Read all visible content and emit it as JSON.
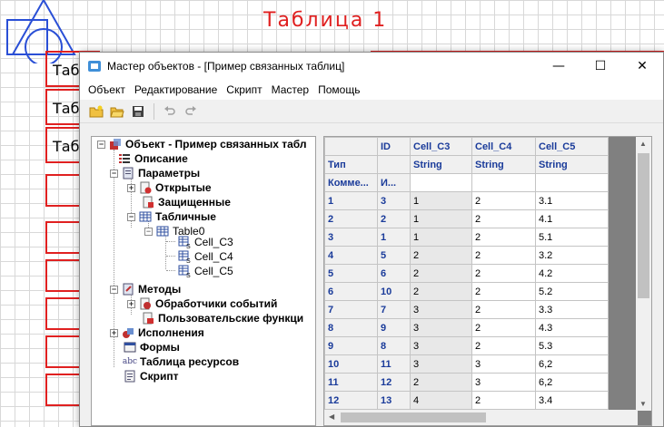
{
  "background": {
    "drawing_title": "Таблица 1",
    "row_labels": [
      "Таб",
      "Таб",
      "Таб"
    ]
  },
  "window": {
    "title": "Мастер объектов - [Пример связанных таблиц]",
    "minimize": "—",
    "maximize": "☐",
    "close": "✕"
  },
  "menu": [
    "Объект",
    "Редактирование",
    "Скрипт",
    "Мастер",
    "Помощь"
  ],
  "toolbar": {
    "icons": [
      "new-folder-icon",
      "open-folder-icon",
      "save-icon",
      "undo-icon",
      "redo-icon"
    ]
  },
  "tree": {
    "root": "Объект - Пример связанных табл",
    "description": "Описание",
    "parameters": "Параметры",
    "open": "Открытые",
    "protected": "Защищенные",
    "tabular": "Табличные",
    "table0": "Table0",
    "cells": [
      "Cell_C3",
      "Cell_C4",
      "Cell_C5"
    ],
    "methods": "Методы",
    "event_handlers": "Обработчики событий",
    "user_functions": "Пользовательские функци",
    "executions": "Исполнения",
    "forms": "Формы",
    "resources": "Таблица ресурсов",
    "script": "Скрипт"
  },
  "grid": {
    "header": [
      "",
      "ID",
      "Cell_C3",
      "Cell_C4",
      "Cell_C5"
    ],
    "type_row": [
      "Тип",
      "",
      "String",
      "String",
      "String"
    ],
    "comment_row": [
      "Комме...",
      "И...",
      "",
      "",
      ""
    ],
    "rows": [
      [
        "1",
        "3",
        "1",
        "2",
        "3.1"
      ],
      [
        "2",
        "2",
        "1",
        "2",
        "4.1"
      ],
      [
        "3",
        "1",
        "1",
        "2",
        "5.1"
      ],
      [
        "4",
        "5",
        "2",
        "2",
        "3.2"
      ],
      [
        "5",
        "6",
        "2",
        "2",
        "4.2"
      ],
      [
        "6",
        "10",
        "2",
        "2",
        "5.2"
      ],
      [
        "7",
        "7",
        "3",
        "2",
        "3.3"
      ],
      [
        "8",
        "9",
        "3",
        "2",
        "4.3"
      ],
      [
        "9",
        "8",
        "3",
        "2",
        "5.3"
      ],
      [
        "10",
        "11",
        "3",
        "3",
        "6,2"
      ],
      [
        "11",
        "12",
        "2",
        "3",
        "6,2"
      ],
      [
        "12",
        "13",
        "4",
        "2",
        "3.4"
      ]
    ]
  }
}
